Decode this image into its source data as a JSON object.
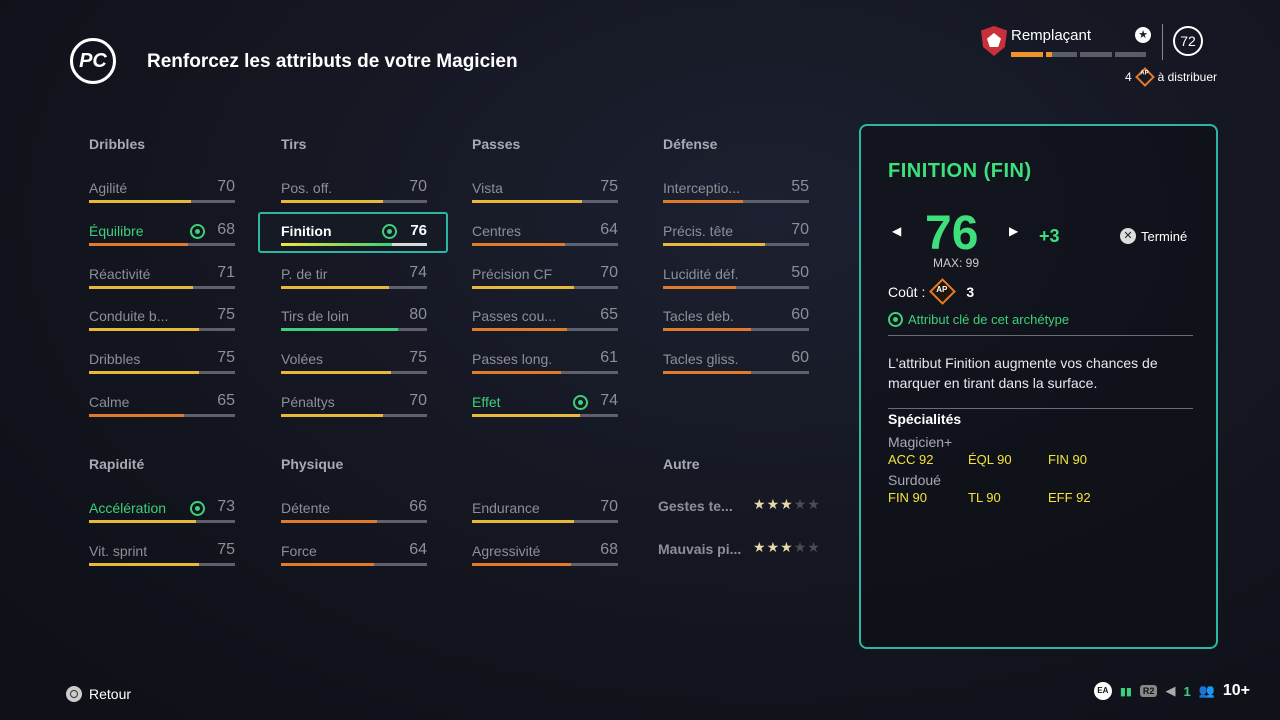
{
  "header": {
    "logo": "PC",
    "title": "Renforcez les attributs de votre Magicien"
  },
  "player": {
    "role": "Remplaçant",
    "level": "72",
    "ap_count": "4",
    "ap_label": "AP",
    "distribute_label": "à distribuer",
    "xp_progress": [
      1,
      0.2,
      0,
      0
    ],
    "colors": {
      "xp_fill": "#f0932b",
      "xp_empty": "#5a5d68",
      "club_badge": "#c9303a"
    }
  },
  "attributes": {
    "colors": {
      "yellow": "#e6b93a",
      "orange": "#e07a2c",
      "green": "#3ecf7a",
      "track": "#5e616b"
    },
    "groups": [
      {
        "title": "Dribbles",
        "rows": [
          {
            "label": "Agilité",
            "value": "70",
            "fill": 0.7,
            "color": "yellow"
          },
          {
            "label": "Équilibre",
            "value": "68",
            "fill": 0.68,
            "color": "orange",
            "key": true
          },
          {
            "label": "Réactivité",
            "value": "71",
            "fill": 0.71,
            "color": "yellow"
          },
          {
            "label": "Conduite b...",
            "value": "75",
            "fill": 0.75,
            "color": "yellow"
          },
          {
            "label": "Dribbles",
            "value": "75",
            "fill": 0.75,
            "color": "yellow"
          },
          {
            "label": "Calme",
            "value": "65",
            "fill": 0.65,
            "color": "orange"
          }
        ]
      },
      {
        "title": "Tirs",
        "rows": [
          {
            "label": "Pos. off.",
            "value": "70",
            "fill": 0.7,
            "color": "yellow"
          },
          {
            "label": "Finition",
            "value": "76",
            "fill": 0.76,
            "color": "green",
            "key": true,
            "selected": true
          },
          {
            "label": "P. de tir",
            "value": "74",
            "fill": 0.74,
            "color": "yellow"
          },
          {
            "label": "Tirs de loin",
            "value": "80",
            "fill": 0.8,
            "color": "green"
          },
          {
            "label": "Volées",
            "value": "75",
            "fill": 0.75,
            "color": "yellow"
          },
          {
            "label": "Pénaltys",
            "value": "70",
            "fill": 0.7,
            "color": "yellow"
          }
        ]
      },
      {
        "title": "Passes",
        "rows": [
          {
            "label": "Vista",
            "value": "75",
            "fill": 0.75,
            "color": "yellow"
          },
          {
            "label": "Centres",
            "value": "64",
            "fill": 0.64,
            "color": "orange"
          },
          {
            "label": "Précision CF",
            "value": "70",
            "fill": 0.7,
            "color": "yellow"
          },
          {
            "label": "Passes cou...",
            "value": "65",
            "fill": 0.65,
            "color": "orange"
          },
          {
            "label": "Passes long.",
            "value": "61",
            "fill": 0.61,
            "color": "orange"
          },
          {
            "label": "Effet",
            "value": "74",
            "fill": 0.74,
            "color": "yellow",
            "key": true
          }
        ]
      },
      {
        "title": "Défense",
        "rows": [
          {
            "label": "Interceptio...",
            "value": "55",
            "fill": 0.55,
            "color": "orange"
          },
          {
            "label": "Précis. tête",
            "value": "70",
            "fill": 0.7,
            "color": "yellow"
          },
          {
            "label": "Lucidité déf.",
            "value": "50",
            "fill": 0.5,
            "color": "orange"
          },
          {
            "label": "Tacles deb.",
            "value": "60",
            "fill": 0.6,
            "color": "orange"
          },
          {
            "label": "Tacles gliss.",
            "value": "60",
            "fill": 0.6,
            "color": "orange"
          }
        ]
      },
      {
        "title": "Rapidité",
        "rows": [
          {
            "label": "Accélération",
            "value": "73",
            "fill": 0.73,
            "color": "yellow",
            "key": true
          },
          {
            "label": "Vit. sprint",
            "value": "75",
            "fill": 0.75,
            "color": "yellow"
          }
        ]
      },
      {
        "title": "Physique",
        "rows": [
          {
            "label": "Détente",
            "value": "66",
            "fill": 0.66,
            "color": "orange"
          },
          {
            "label": "Force",
            "value": "64",
            "fill": 0.64,
            "color": "orange"
          }
        ]
      },
      {
        "title": "",
        "rows": [
          {
            "label": "Endurance",
            "value": "70",
            "fill": 0.7,
            "color": "yellow"
          },
          {
            "label": "Agressivité",
            "value": "68",
            "fill": 0.68,
            "color": "orange"
          }
        ]
      }
    ],
    "autre": {
      "title": "Autre",
      "rows": [
        {
          "label": "Gestes te...",
          "stars": 3,
          "max": 5
        },
        {
          "label": "Mauvais pi...",
          "stars": 3,
          "max": 5
        }
      ]
    }
  },
  "panel": {
    "title": "FINITION (FIN)",
    "value": "76",
    "max_label": "MAX: 99",
    "increase": "+3",
    "done_label": "Terminé",
    "cost_label": "Coût :",
    "cost_icon": "AP",
    "cost_value": "3",
    "key_label": "Attribut clé de cet archétype",
    "description": "L'attribut Finition augmente vos chances de marquer en tirant dans la surface.",
    "specialties_title": "Spécialités",
    "specialties": [
      {
        "name": "Magicien+",
        "stats": [
          "ACC 92",
          "ÉQL 90",
          "FIN 90"
        ]
      },
      {
        "name": "Surdoué",
        "stats": [
          "FIN 90",
          "TL 90",
          "EFF 92"
        ]
      }
    ],
    "arrow_left": "◀",
    "arrow_right": "▶"
  },
  "footer": {
    "back_label": "Retour",
    "ea_label": "EA",
    "r2_label": "R2",
    "count_1": "1",
    "friends": "10+"
  }
}
